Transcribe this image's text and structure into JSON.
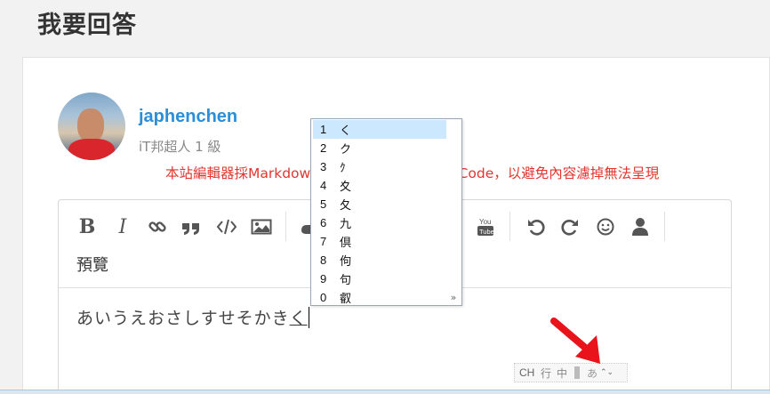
{
  "page": {
    "heading": "我要回答"
  },
  "user": {
    "name": "japhenchen",
    "level": "iT邦超人 1 級"
  },
  "notice": "本站編輯器採Markdown格式，請勿貼上HTML Code，以避免內容濾掉無法呈現",
  "toolbar": {
    "bold_label": "B",
    "italic_label": "I",
    "preview_label": "預覽",
    "icons": [
      "link-icon",
      "quote-icon",
      "code-icon",
      "image-icon",
      "youtube-icon",
      "undo-icon",
      "redo-icon",
      "emoji-icon",
      "user-icon"
    ]
  },
  "editor": {
    "committed_text": "あいうえおさしすせそかき",
    "composing_text": "く"
  },
  "ime": {
    "candidates": [
      {
        "num": "1",
        "char": "く"
      },
      {
        "num": "2",
        "char": "ク"
      },
      {
        "num": "3",
        "char": "ｸ"
      },
      {
        "num": "4",
        "char": "夊"
      },
      {
        "num": "5",
        "char": "夂"
      },
      {
        "num": "6",
        "char": "九"
      },
      {
        "num": "7",
        "char": "倶"
      },
      {
        "num": "8",
        "char": "佝"
      },
      {
        "num": "9",
        "char": "句"
      },
      {
        "num": "0",
        "char": "叡"
      }
    ],
    "selected_index": 0,
    "more_symbol": "»"
  },
  "langbar": {
    "lang": "CH",
    "mode_icon": "行",
    "input": "中",
    "kana": "あ",
    "menu_symbol": "⌃⌄"
  },
  "colors": {
    "link": "#2a8fd8",
    "notice": "#e2362e",
    "selection": "#cce8ff",
    "arrow": "#e8131b"
  }
}
